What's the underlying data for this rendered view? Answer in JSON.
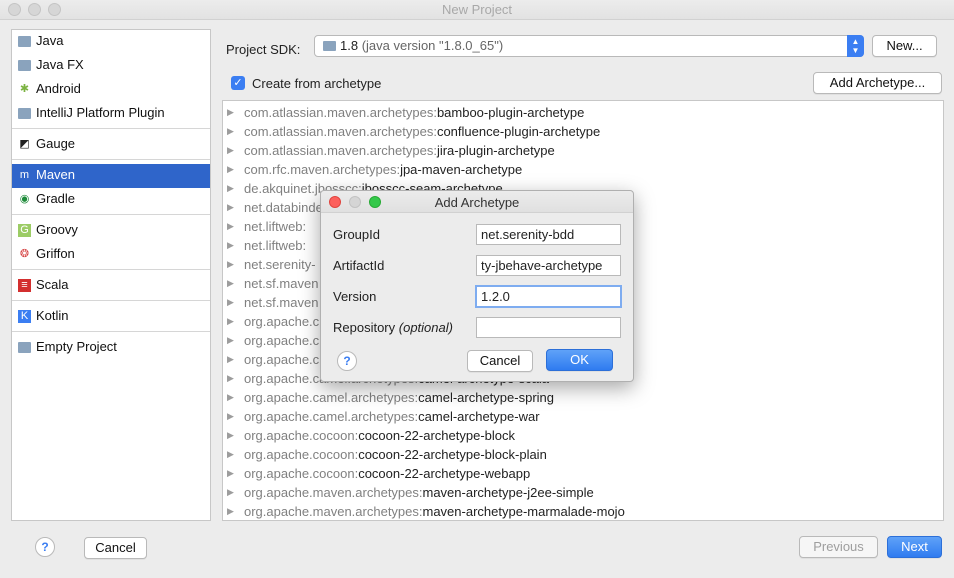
{
  "window": {
    "title": "New Project"
  },
  "project_types": [
    {
      "label": "Java",
      "icon": "folder-icon"
    },
    {
      "label": "Java FX",
      "icon": "folder-icon"
    },
    {
      "label": "Android",
      "icon": "android-icon"
    },
    {
      "label": "IntelliJ Platform Plugin",
      "icon": "plugin-icon"
    },
    {
      "label": "Gauge",
      "icon": "gauge-icon"
    },
    {
      "label": "Maven",
      "icon": "maven-icon",
      "selected": true
    },
    {
      "label": "Gradle",
      "icon": "gradle-icon"
    },
    {
      "label": "Groovy",
      "icon": "groovy-icon"
    },
    {
      "label": "Griffon",
      "icon": "griffon-icon"
    },
    {
      "label": "Scala",
      "icon": "scala-icon"
    },
    {
      "label": "Kotlin",
      "icon": "kotlin-icon"
    },
    {
      "label": "Empty Project",
      "icon": "folder-icon"
    }
  ],
  "sdk": {
    "label": "Project SDK:",
    "value_main": "1.8",
    "value_detail": "(java version \"1.8.0_65\")",
    "new_button": "New..."
  },
  "archetype_checkbox": {
    "label": "Create from archetype",
    "checked": true
  },
  "add_archetype_button": "Add Archetype...",
  "archetypes": [
    {
      "group": "com.atlassian.maven.archetypes:",
      "artifact": "bamboo-plugin-archetype"
    },
    {
      "group": "com.atlassian.maven.archetypes:",
      "artifact": "confluence-plugin-archetype"
    },
    {
      "group": "com.atlassian.maven.archetypes:",
      "artifact": "jira-plugin-archetype"
    },
    {
      "group": "com.rfc.maven.archetypes:",
      "artifact": "jpa-maven-archetype"
    },
    {
      "group": "de.akquinet.jbosscc:",
      "artifact": "jbosscc-seam-archetype"
    },
    {
      "group": "net.databinder:",
      "artifact": ""
    },
    {
      "group": "net.liftweb:",
      "artifact": ""
    },
    {
      "group": "net.liftweb:",
      "artifact": ""
    },
    {
      "group": "net.serenity-",
      "artifact": ""
    },
    {
      "group": "net.sf.maven",
      "artifact": ""
    },
    {
      "group": "net.sf.maven",
      "artifact": ""
    },
    {
      "group": "org.apache.c",
      "artifact": ""
    },
    {
      "group": "org.apache.c",
      "artifact": ""
    },
    {
      "group": "org.apache.c",
      "artifact": ""
    },
    {
      "group": "org.apache.camel.archetypes:",
      "artifact": "camel-archetype-scala"
    },
    {
      "group": "org.apache.camel.archetypes:",
      "artifact": "camel-archetype-spring"
    },
    {
      "group": "org.apache.camel.archetypes:",
      "artifact": "camel-archetype-war"
    },
    {
      "group": "org.apache.cocoon:",
      "artifact": "cocoon-22-archetype-block"
    },
    {
      "group": "org.apache.cocoon:",
      "artifact": "cocoon-22-archetype-block-plain"
    },
    {
      "group": "org.apache.cocoon:",
      "artifact": "cocoon-22-archetype-webapp"
    },
    {
      "group": "org.apache.maven.archetypes:",
      "artifact": "maven-archetype-j2ee-simple"
    },
    {
      "group": "org.apache.maven.archetypes:",
      "artifact": "maven-archetype-marmalade-mojo"
    }
  ],
  "dialog": {
    "title": "Add Archetype",
    "group_label": "GroupId",
    "group_value": "net.serenity-bdd",
    "artifact_label": "ArtifactId",
    "artifact_value": "ty-jbehave-archetype",
    "version_label": "Version",
    "version_value": "1.2.0",
    "repository_label": "Repository",
    "repository_optional": "(optional)",
    "repository_value": "",
    "help": "?",
    "cancel": "Cancel",
    "ok": "OK"
  },
  "footer": {
    "help": "?",
    "cancel": "Cancel",
    "previous": "Previous",
    "next": "Next"
  },
  "colors": {
    "accent": "#2f65ca",
    "button_blue": "#3b7ef2"
  }
}
